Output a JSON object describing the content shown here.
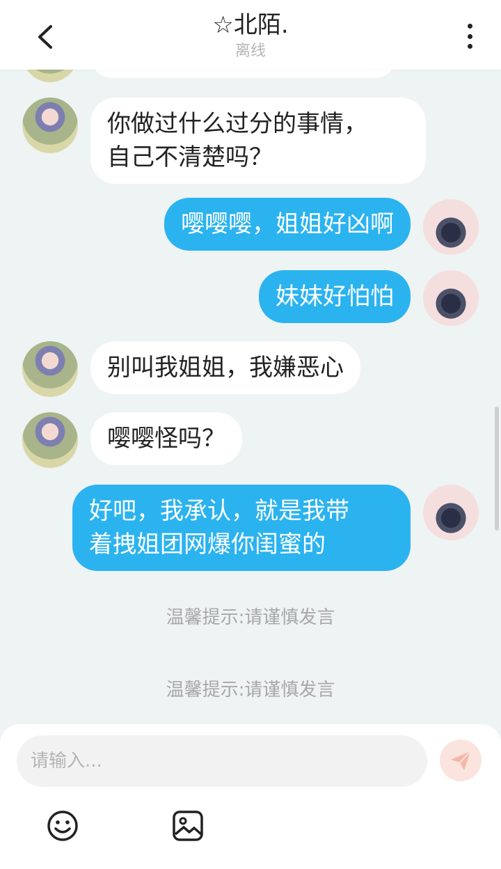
{
  "header": {
    "title": "☆北陌.",
    "status": "离线"
  },
  "messages": [
    {
      "side": "other",
      "text": ""
    },
    {
      "side": "other",
      "text": "你做过什么过分的事情，\n自己不清楚吗？"
    },
    {
      "side": "self",
      "text": "嘤嘤嘤，姐姐好凶啊"
    },
    {
      "side": "self",
      "text": "妹妹好怕怕"
    },
    {
      "side": "other",
      "text": "别叫我姐姐，我嫌恶心"
    },
    {
      "side": "other",
      "text": "嘤嘤怪吗？"
    },
    {
      "side": "self",
      "text": "好吧，我承认，就是我带\n着拽姐团网爆你闺蜜的"
    }
  ],
  "hints": [
    "温馨提示:请谨慎发言",
    "温馨提示:请谨慎发言"
  ],
  "composer": {
    "placeholder": "请输入..."
  },
  "colors": {
    "self_bubble": "#2bb3f0",
    "other_bubble": "#ffffff",
    "background": "#eef3f3",
    "send_button": "#fbe4de"
  },
  "icons": {
    "back": "chevron-left-icon",
    "more": "more-vertical-icon",
    "send": "paper-plane-icon",
    "emoji": "smiley-icon",
    "image": "image-icon"
  }
}
